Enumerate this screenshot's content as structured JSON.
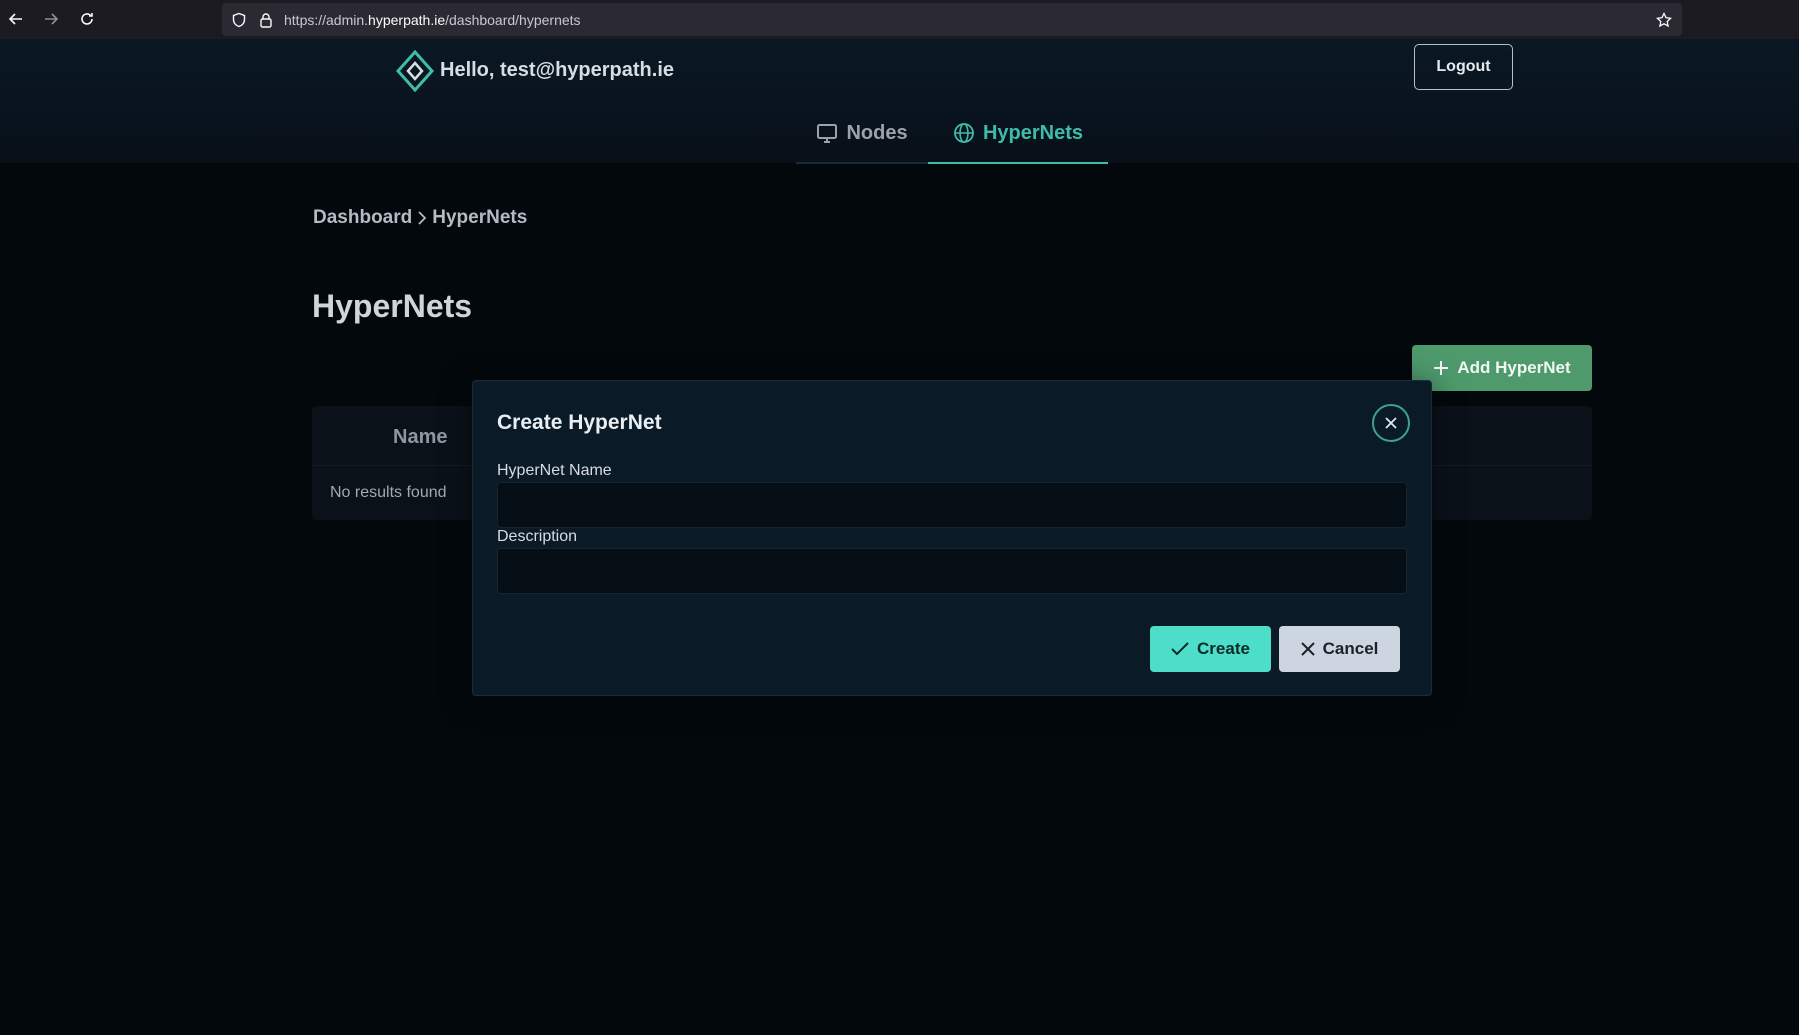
{
  "browser": {
    "url_prefix": "https://admin.",
    "url_domain": "hyperpath.ie",
    "url_path": "/dashboard/hypernets"
  },
  "header": {
    "greeting": "Hello, test@hyperpath.ie",
    "logout_label": "Logout",
    "tabs": [
      {
        "label": "Nodes",
        "icon": "monitor-icon",
        "active": false
      },
      {
        "label": "HyperNets",
        "icon": "globe-icon",
        "active": true
      }
    ]
  },
  "breadcrumb": {
    "items": [
      "Dashboard",
      "HyperNets"
    ]
  },
  "page": {
    "title": "HyperNets",
    "add_button_label": "Add HyperNet"
  },
  "table": {
    "columns": [
      "Name"
    ],
    "empty_text": "No results found"
  },
  "modal": {
    "title": "Create HyperNet",
    "fields": [
      {
        "label": "HyperNet Name",
        "value": "",
        "placeholder": ""
      },
      {
        "label": "Description",
        "value": "",
        "placeholder": ""
      }
    ],
    "create_label": "Create",
    "cancel_label": "Cancel"
  },
  "colors": {
    "accent": "#3fbca9",
    "create_button": "#4ddec9",
    "add_button": "#4e9a6d",
    "background": "#03080d"
  }
}
